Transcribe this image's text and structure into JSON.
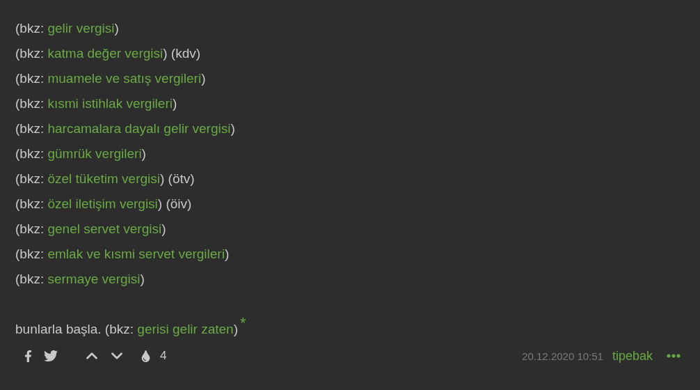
{
  "entry": {
    "paragraphs": [
      {
        "lines": [
          {
            "parts": [
              {
                "kind": "text",
                "text": "(bkz: "
              },
              {
                "kind": "link",
                "text": "gelir vergisi"
              },
              {
                "kind": "text",
                "text": ")"
              }
            ]
          },
          {
            "parts": [
              {
                "kind": "text",
                "text": "(bkz: "
              },
              {
                "kind": "link",
                "text": "katma değer vergisi"
              },
              {
                "kind": "text",
                "text": ") (kdv)"
              }
            ]
          },
          {
            "parts": [
              {
                "kind": "text",
                "text": "(bkz: "
              },
              {
                "kind": "link",
                "text": "muamele ve satış vergileri"
              },
              {
                "kind": "text",
                "text": ")"
              }
            ]
          },
          {
            "parts": [
              {
                "kind": "text",
                "text": "(bkz: "
              },
              {
                "kind": "link",
                "text": "kısmi istihlak vergileri"
              },
              {
                "kind": "text",
                "text": ")"
              }
            ]
          },
          {
            "parts": [
              {
                "kind": "text",
                "text": "(bkz: "
              },
              {
                "kind": "link",
                "text": "harcamalara dayalı gelir vergisi"
              },
              {
                "kind": "text",
                "text": ")"
              }
            ]
          },
          {
            "parts": [
              {
                "kind": "text",
                "text": "(bkz: "
              },
              {
                "kind": "link",
                "text": "gümrük vergileri"
              },
              {
                "kind": "text",
                "text": ")"
              }
            ]
          },
          {
            "parts": [
              {
                "kind": "text",
                "text": "(bkz: "
              },
              {
                "kind": "link",
                "text": "özel tüketim vergisi"
              },
              {
                "kind": "text",
                "text": ") (ötv)"
              }
            ]
          },
          {
            "parts": [
              {
                "kind": "text",
                "text": "(bkz: "
              },
              {
                "kind": "link",
                "text": "özel iletişim vergisi"
              },
              {
                "kind": "text",
                "text": ") (öiv)"
              }
            ]
          },
          {
            "parts": [
              {
                "kind": "text",
                "text": "(bkz: "
              },
              {
                "kind": "link",
                "text": "genel servet vergisi"
              },
              {
                "kind": "text",
                "text": ")"
              }
            ]
          },
          {
            "parts": [
              {
                "kind": "text",
                "text": "(bkz: "
              },
              {
                "kind": "link",
                "text": "emlak ve kısmi servet vergileri"
              },
              {
                "kind": "text",
                "text": ")"
              }
            ]
          },
          {
            "parts": [
              {
                "kind": "text",
                "text": "(bkz: "
              },
              {
                "kind": "link",
                "text": "sermaye vergisi"
              },
              {
                "kind": "text",
                "text": ")"
              }
            ]
          }
        ]
      },
      {
        "lines": [
          {
            "parts": [
              {
                "kind": "text",
                "text": "bunlarla başla. (bkz: "
              },
              {
                "kind": "link",
                "text": "gerisi gelir zaten"
              },
              {
                "kind": "text",
                "text": ")"
              },
              {
                "kind": "sup",
                "text": "*"
              }
            ]
          }
        ]
      }
    ]
  },
  "footer": {
    "favorites": "4",
    "date": "20.12.2020 10:51",
    "author": "tipebak"
  }
}
